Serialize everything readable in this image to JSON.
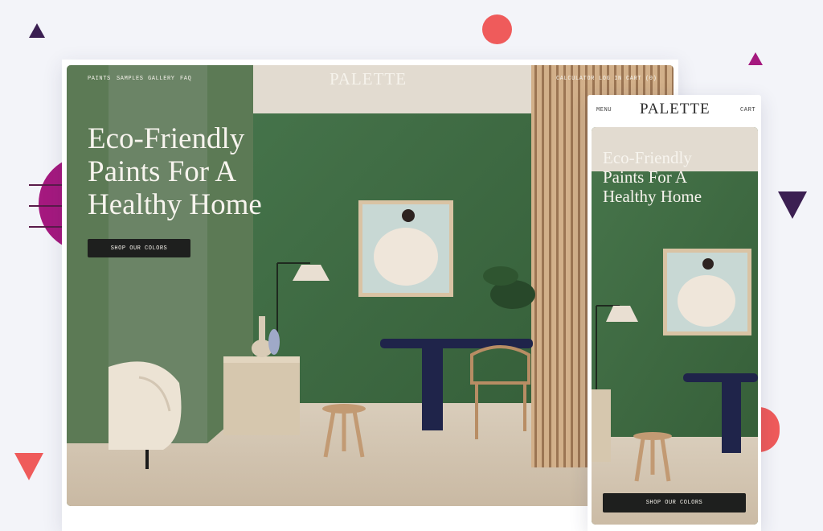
{
  "desktop": {
    "nav_left": [
      "PAINTS",
      "SAMPLES",
      "GALLERY",
      "FAQ"
    ],
    "logo": "PALETTE",
    "nav_right": [
      "CALCULATOR",
      "LOG IN",
      "CART (0)"
    ],
    "headline": "Eco-Friendly\nPaints For A\nHealthy Home",
    "cta": "SHOP OUR COLORS"
  },
  "mobile": {
    "menu": "MENU",
    "logo": "PALETTE",
    "cart": "CART",
    "headline": "Eco-Friendly\nPaints For A\nHealthy Home",
    "cta": "SHOP OUR COLORS"
  },
  "colors": {
    "background": "#f3f4f9",
    "wall_green": "#3e6c3e",
    "accent_coral": "#ef5b5b",
    "accent_magenta": "#a5197f",
    "accent_purple": "#3b1f52",
    "button_dark": "#1e1f1e"
  }
}
